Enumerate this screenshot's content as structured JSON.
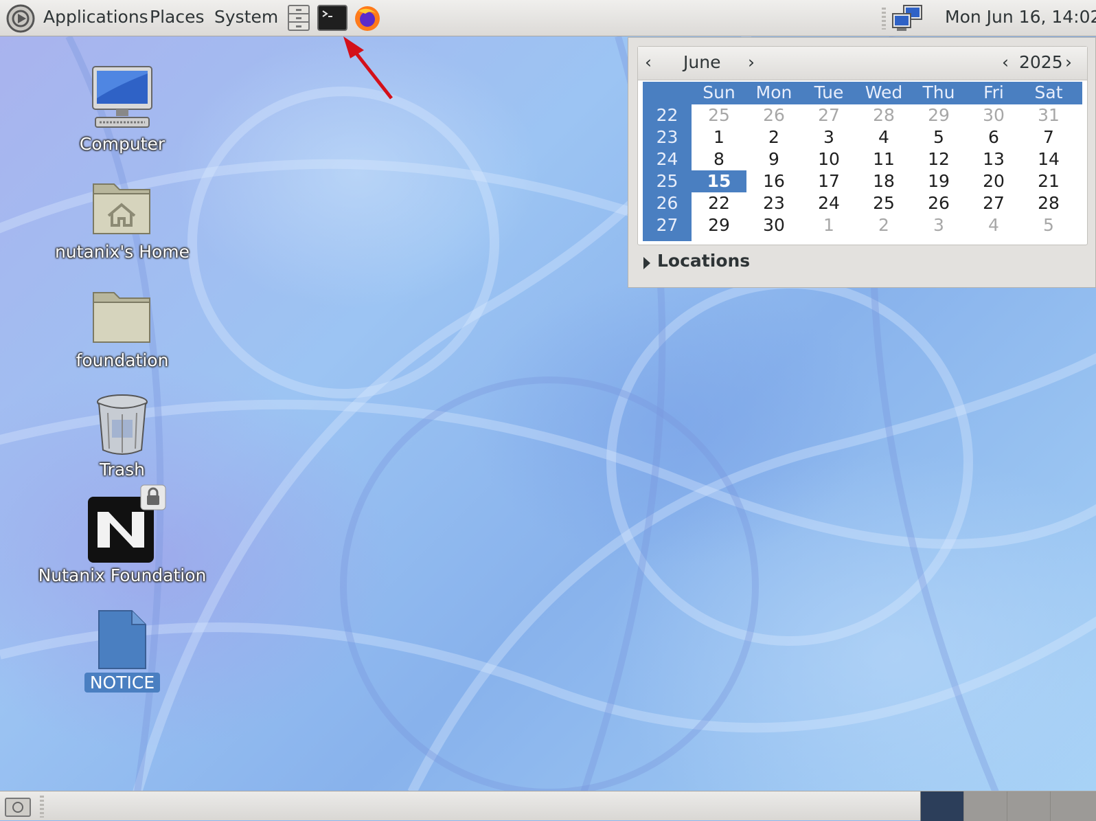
{
  "top_panel": {
    "menus": [
      "Applications",
      "Places",
      "System"
    ],
    "launchers": [
      "file-manager-icon",
      "terminal-icon",
      "firefox-icon"
    ],
    "clock": "Mon Jun 16, 14:02"
  },
  "desktop_icons": [
    {
      "label": "Computer",
      "icon": "computer-icon"
    },
    {
      "label": "nutanix's Home",
      "icon": "home-folder-icon"
    },
    {
      "label": "foundation",
      "icon": "folder-icon"
    },
    {
      "label": "Trash",
      "icon": "trash-icon"
    },
    {
      "label": "Nutanix Foundation",
      "icon": "nutanix-logo-icon"
    },
    {
      "label": "NOTICE",
      "icon": "document-icon"
    }
  ],
  "calendar": {
    "month": "June",
    "year": "2025",
    "day_names": [
      "Sun",
      "Mon",
      "Tue",
      "Wed",
      "Thu",
      "Fri",
      "Sat"
    ],
    "weeks": [
      {
        "num": "22",
        "days": [
          "25",
          "26",
          "27",
          "28",
          "29",
          "30",
          "31"
        ]
      },
      {
        "num": "23",
        "days": [
          "1",
          "2",
          "3",
          "4",
          "5",
          "6",
          "7"
        ]
      },
      {
        "num": "24",
        "days": [
          "8",
          "9",
          "10",
          "11",
          "12",
          "13",
          "14"
        ]
      },
      {
        "num": "25",
        "days": [
          "15",
          "16",
          "17",
          "18",
          "19",
          "20",
          "21"
        ]
      },
      {
        "num": "26",
        "days": [
          "22",
          "23",
          "24",
          "25",
          "26",
          "27",
          "28"
        ]
      },
      {
        "num": "27",
        "days": [
          "29",
          "30",
          "1",
          "2",
          "3",
          "4",
          "5"
        ]
      }
    ],
    "other_month_cells": [
      [
        0,
        0
      ],
      [
        0,
        1
      ],
      [
        0,
        2
      ],
      [
        0,
        3
      ],
      [
        0,
        4
      ],
      [
        0,
        5
      ],
      [
        0,
        6
      ],
      [
        5,
        2
      ],
      [
        5,
        3
      ],
      [
        5,
        4
      ],
      [
        5,
        5
      ],
      [
        5,
        6
      ]
    ],
    "selected_day": "15",
    "locations_label": "Locations"
  },
  "colors": {
    "accent": "#4a7fc1",
    "annotation_arrow": "#d3101a"
  }
}
